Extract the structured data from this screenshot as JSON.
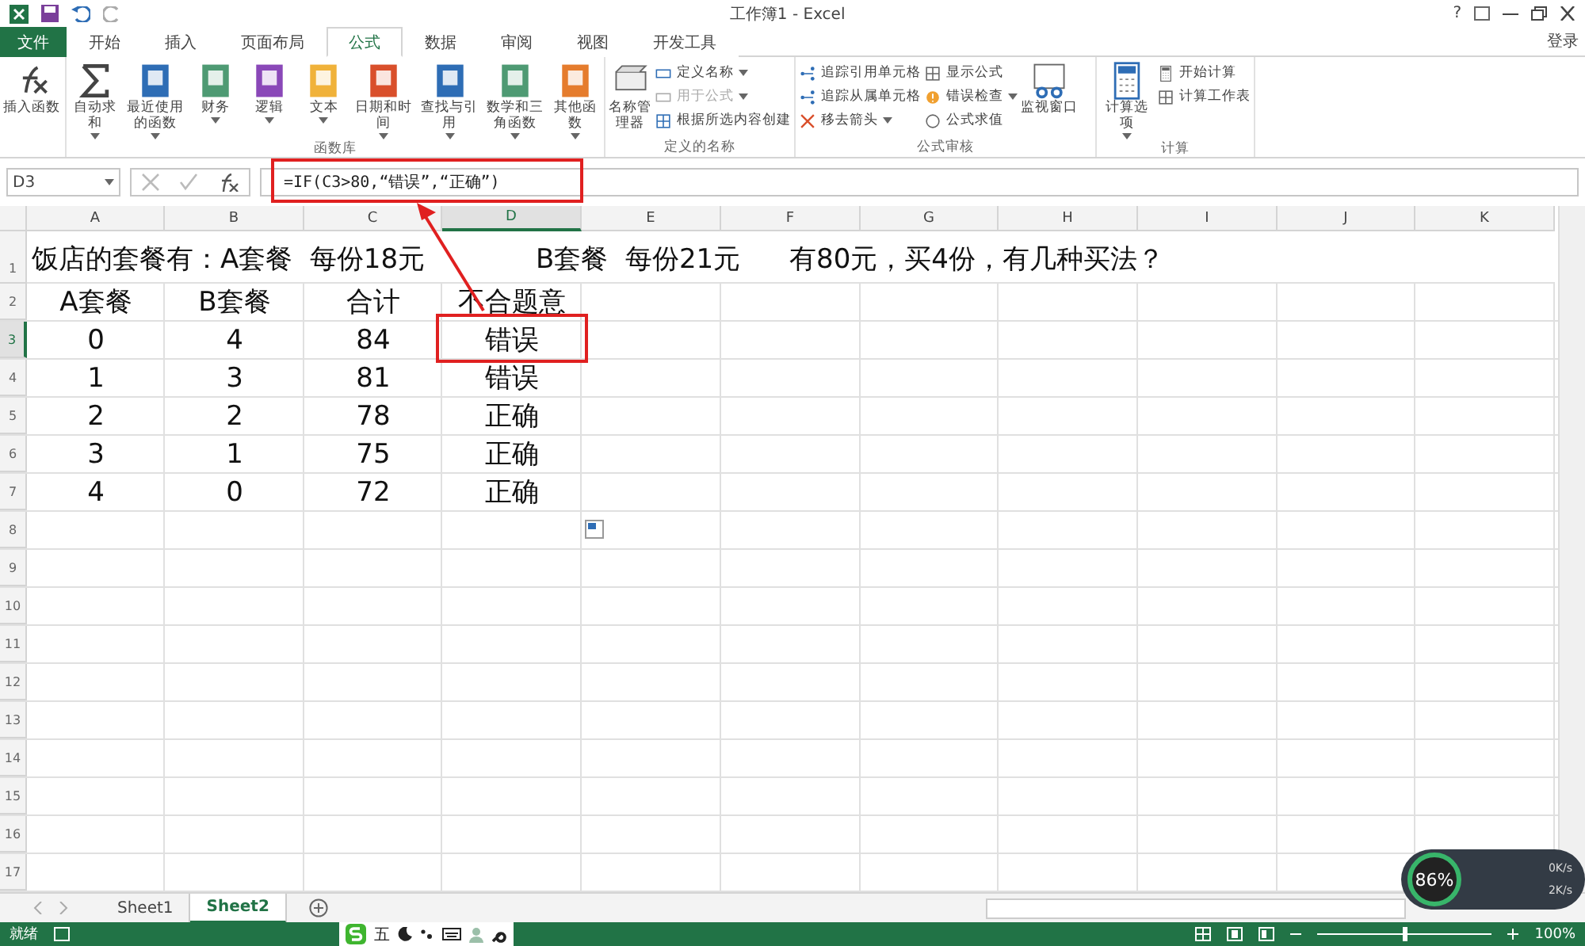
{
  "title_bar": {
    "title": "工作簿1 - Excel",
    "help": "?",
    "login": "登录"
  },
  "tabs": [
    {
      "label": "文件",
      "kind": "file",
      "selected": false
    },
    {
      "label": "开始",
      "kind": "tab",
      "selected": false
    },
    {
      "label": "插入",
      "kind": "tab",
      "selected": false
    },
    {
      "label": "页面布局",
      "kind": "tab",
      "selected": false
    },
    {
      "label": "公式",
      "kind": "tab",
      "selected": true
    },
    {
      "label": "数据",
      "kind": "tab",
      "selected": false
    },
    {
      "label": "审阅",
      "kind": "tab",
      "selected": false
    },
    {
      "label": "视图",
      "kind": "tab",
      "selected": false
    },
    {
      "label": "开发工具",
      "kind": "tab",
      "selected": false
    }
  ],
  "ribbon": {
    "groups": [
      {
        "items": [
          {
            "kind": "large",
            "label": "插入函数"
          }
        ]
      },
      {
        "label": "函数库",
        "items": [
          {
            "kind": "large",
            "label": "自动求和"
          },
          {
            "kind": "large",
            "label": "最近使用的函数"
          },
          {
            "kind": "large",
            "label": "财务"
          },
          {
            "kind": "large",
            "label": "逻辑"
          },
          {
            "kind": "large",
            "label": "文本"
          },
          {
            "kind": "large",
            "label": "日期和时间"
          },
          {
            "kind": "large",
            "label": "查找与引用"
          },
          {
            "kind": "large",
            "label": "数学和三角函数"
          },
          {
            "kind": "large",
            "label": "其他函数"
          }
        ]
      },
      {
        "label": "定义的名称",
        "items": [
          {
            "kind": "large",
            "label": "名称管理器"
          },
          {
            "kind": "small",
            "label": "定义名称",
            "disabled": false
          },
          {
            "kind": "small",
            "label": "用于公式",
            "disabled": true
          },
          {
            "kind": "small",
            "label": "根据所选内容创建",
            "disabled": false
          }
        ]
      },
      {
        "label": "公式审核",
        "items": [
          {
            "kind": "small",
            "label": "追踪引用单元格",
            "disabled": false
          },
          {
            "kind": "small",
            "label": "追踪从属单元格",
            "disabled": false
          },
          {
            "kind": "small",
            "label": "移去箭头",
            "disabled": false
          },
          {
            "kind": "small",
            "label": "显示公式",
            "disabled": false
          },
          {
            "kind": "small",
            "label": "错误检查",
            "disabled": false
          },
          {
            "kind": "small",
            "label": "公式求值",
            "disabled": false
          },
          {
            "kind": "large",
            "label": "监视窗口"
          }
        ]
      },
      {
        "label": "计算",
        "items": [
          {
            "kind": "large",
            "label": "计算选项"
          },
          {
            "kind": "small",
            "label": "开始计算",
            "disabled": false
          },
          {
            "kind": "small",
            "label": "计算工作表",
            "disabled": false
          }
        ]
      }
    ]
  },
  "formula_bar": {
    "name_box": "D3",
    "formula": "=IF(C3>80,“错误”,“正确”)"
  },
  "columns": [
    {
      "label": "A",
      "selected": false
    },
    {
      "label": "B",
      "selected": false
    },
    {
      "label": "C",
      "selected": false
    },
    {
      "label": "D",
      "selected": true
    },
    {
      "label": "E",
      "selected": false
    },
    {
      "label": "F",
      "selected": false
    },
    {
      "label": "G",
      "selected": false
    },
    {
      "label": "H",
      "selected": false
    },
    {
      "label": "I",
      "selected": false
    },
    {
      "label": "J",
      "selected": false
    },
    {
      "label": "K",
      "selected": false
    }
  ],
  "title_row": {
    "number": "1",
    "parts": [
      "饭店的套餐有：A套餐  每份18元",
      "B套餐  每份21元",
      "有80元，买4份，有几种买法？"
    ]
  },
  "rows": [
    {
      "number": "2",
      "selected": false,
      "cells": [
        "A套餐",
        "B套餐",
        "合计",
        "不合题意"
      ]
    },
    {
      "number": "3",
      "selected": true,
      "cells": [
        "0",
        "4",
        "84",
        "错误"
      ]
    },
    {
      "number": "4",
      "selected": false,
      "cells": [
        "1",
        "3",
        "81",
        "错误"
      ]
    },
    {
      "number": "5",
      "selected": false,
      "cells": [
        "2",
        "2",
        "78",
        "正确"
      ]
    },
    {
      "number": "6",
      "selected": false,
      "cells": [
        "3",
        "1",
        "75",
        "正确"
      ]
    },
    {
      "number": "7",
      "selected": false,
      "cells": [
        "4",
        "0",
        "72",
        "正确"
      ]
    },
    {
      "number": "8",
      "selected": false
    },
    {
      "number": "9",
      "selected": false
    },
    {
      "number": "10",
      "selected": false
    },
    {
      "number": "11",
      "selected": false
    },
    {
      "number": "12",
      "selected": false
    },
    {
      "number": "13",
      "selected": false
    },
    {
      "number": "14",
      "selected": false
    },
    {
      "number": "15",
      "selected": false
    },
    {
      "number": "16",
      "selected": false
    },
    {
      "number": "17",
      "selected": false
    }
  ],
  "sheet_tabs": [
    {
      "label": "Sheet1",
      "selected": false
    },
    {
      "label": "Sheet2",
      "selected": true
    }
  ],
  "status_bar": {
    "status": "就绪",
    "ime": "五",
    "zoom": "100%",
    "zoom_level": {
      "level": 0.5
    }
  },
  "net_widget": {
    "percent": "86%",
    "up": "0K/s",
    "down": "2K/s"
  }
}
